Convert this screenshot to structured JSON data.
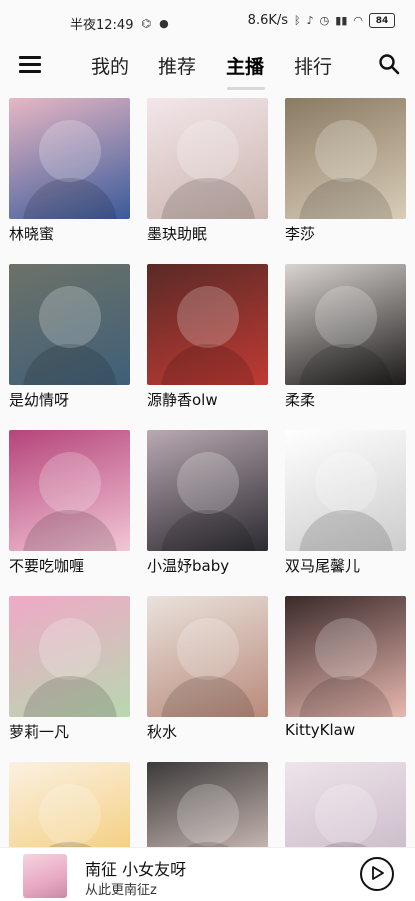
{
  "status_bar": {
    "time": "半夜12:49",
    "speed": "8.6K/s",
    "battery": "84"
  },
  "nav": {
    "tabs": [
      {
        "label": "我的",
        "active": false
      },
      {
        "label": "推荐",
        "active": false
      },
      {
        "label": "主播",
        "active": true
      },
      {
        "label": "排行",
        "active": false
      }
    ]
  },
  "streamers": [
    {
      "name": "林晓蜜",
      "thumb_colors": [
        "#e7b7c4",
        "#3a5a9a"
      ]
    },
    {
      "name": "墨玦助眠",
      "thumb_colors": [
        "#f3e6ea",
        "#c9b4ad"
      ]
    },
    {
      "name": "李莎",
      "thumb_colors": [
        "#8a7a62",
        "#d9cdb8"
      ]
    },
    {
      "name": "是幼情呀",
      "thumb_colors": [
        "#6d7268",
        "#3f5f78"
      ]
    },
    {
      "name": "源静香olw",
      "thumb_colors": [
        "#5a2a26",
        "#c03a34"
      ]
    },
    {
      "name": "柔柔",
      "thumb_colors": [
        "#d9d4d0",
        "#1c1a1a"
      ]
    },
    {
      "name": "不要吃咖喱",
      "thumb_colors": [
        "#b5447a",
        "#f2c6d6"
      ]
    },
    {
      "name": "小温妤baby",
      "thumb_colors": [
        "#b9a9b2",
        "#2c2a30"
      ]
    },
    {
      "name": "双马尾馨儿",
      "thumb_colors": [
        "#ffffff",
        "#cccccc"
      ]
    },
    {
      "name": "萝莉一凡",
      "thumb_colors": [
        "#f0a9c7",
        "#b8d7b0"
      ]
    },
    {
      "name": "秋水",
      "thumb_colors": [
        "#e9e2dc",
        "#b98a7a"
      ]
    },
    {
      "name": "KittyKlaw",
      "thumb_colors": [
        "#3a2a2a",
        "#e8b8b0"
      ]
    },
    {
      "name": "",
      "thumb_colors": [
        "#fbf1e2",
        "#f2c76a"
      ]
    },
    {
      "name": "",
      "thumb_colors": [
        "#3c3a3a",
        "#e9d6cf"
      ]
    },
    {
      "name": "",
      "thumb_colors": [
        "#eee4ea",
        "#c4b3c4"
      ]
    }
  ],
  "player": {
    "title": "南征 小女友呀",
    "subtitle": "从此更南征z"
  },
  "colors": {
    "background": "#fafafa",
    "text": "#111111",
    "tab_underline": "#d8d8d8"
  },
  "icons": {
    "menu": "hamburger-menu-icon",
    "search": "search-icon",
    "play": "play-circle-icon"
  }
}
